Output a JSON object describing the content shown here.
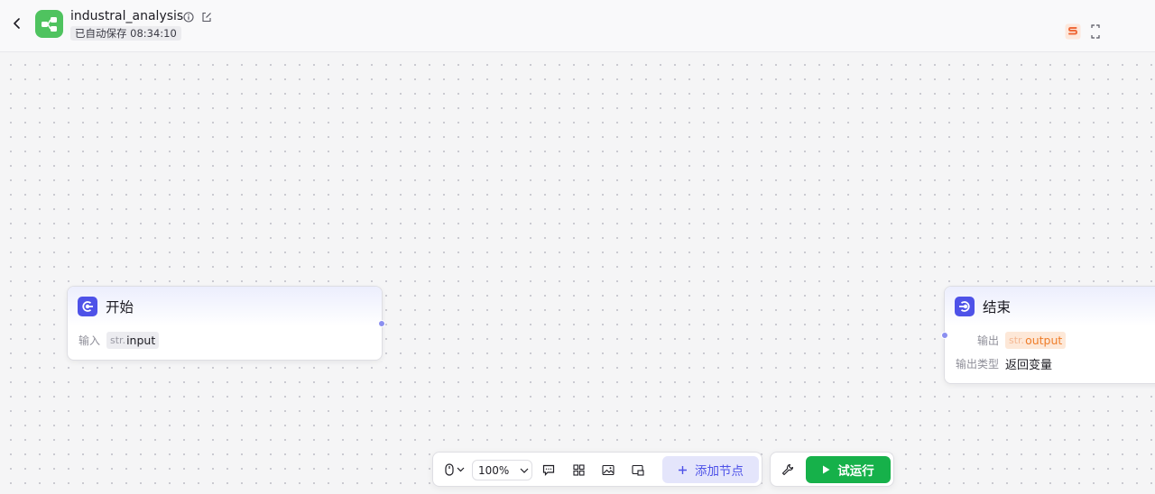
{
  "header": {
    "app_name": "industral_analysis",
    "autosave_text": "已自动保存 08:34:10",
    "icons": {
      "back": "chevron-left-icon",
      "logo": "workflow-logo-icon",
      "info": "info-icon",
      "edit": "edit-icon",
      "extension": "s-badge-icon",
      "fullscreen": "expand-icon"
    }
  },
  "nodes": {
    "start": {
      "title": "开始",
      "input_label": "输入",
      "input_var_prefix": "str.",
      "input_var_name": "input"
    },
    "end": {
      "title": "结束",
      "output_label": "输出",
      "output_var_prefix": "str.",
      "output_var_name": "output",
      "output_type_label": "输出类型",
      "output_type_value": "返回变量"
    }
  },
  "toolbar": {
    "zoom": "100%",
    "add_node_label": "添加节点",
    "run_label": "试运行"
  },
  "colors": {
    "accent": "#4e52e8",
    "run_green": "#16b14a",
    "logo_green": "#4fc35f",
    "output_orange": "#ef7d2a",
    "port": "#8b8ff0"
  }
}
